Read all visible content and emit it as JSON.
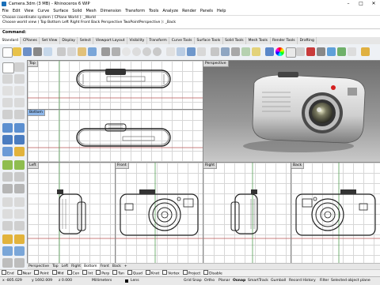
{
  "window": {
    "title": "Camera.3dm (3 MB) - Rhinoceros 6 WIP",
    "minimize": "–",
    "maximize": "□",
    "close": "✕"
  },
  "menu": [
    "File",
    "Edit",
    "View",
    "Curve",
    "Surface",
    "Solid",
    "Mesh",
    "Dimension",
    "Transform",
    "Tools",
    "Analyze",
    "Render",
    "Panels",
    "Help"
  ],
  "history": [
    "Choose coordinate system ( CPlane  World ): _World",
    "Choose world view ( Top  Bottom  Left  Right  Front  Back  Perspective  TwoPointPerspective ): _Back"
  ],
  "command": {
    "label": "Command:"
  },
  "toolbar_tabs": [
    "Standard",
    "CPlanes",
    "Set View",
    "Display",
    "Select",
    "Viewport Layout",
    "Visibility",
    "Transform",
    "Curve Tools",
    "Surface Tools",
    "Solid Tools",
    "Mesh Tools",
    "Render Tools",
    "Drafting"
  ],
  "toolbar_tabs_active": 0,
  "viewports": {
    "top": "Top",
    "bottom": "Bottom",
    "perspective": "Perspective",
    "left": "Left",
    "front": "Front",
    "right": "Right",
    "back": "Back"
  },
  "viewport_tabs": [
    "Perspective",
    "Top",
    "Left",
    "Right",
    "Bottom",
    "Front",
    "Back",
    "+"
  ],
  "viewport_tabs_active": 4,
  "osnaps": [
    {
      "label": "End",
      "checked": false
    },
    {
      "label": "Near",
      "checked": false
    },
    {
      "label": "Point",
      "checked": false
    },
    {
      "label": "Mid",
      "checked": false
    },
    {
      "label": "Cen",
      "checked": false
    },
    {
      "label": "Int",
      "checked": false
    },
    {
      "label": "Perp",
      "checked": false
    },
    {
      "label": "Tan",
      "checked": false
    },
    {
      "label": "Quad",
      "checked": false
    },
    {
      "label": "Knot",
      "checked": false
    },
    {
      "label": "Vertex",
      "checked": false
    },
    {
      "label": "Project",
      "checked": false
    },
    {
      "label": "Disable",
      "checked": false
    }
  ],
  "status": {
    "x": "x -805.029",
    "y": "y 1692.009",
    "z": "z 0.000",
    "units": "Millimeters",
    "layer": "Lens",
    "grid_snap": "Grid Snap",
    "ortho": "Ortho",
    "planar": "Planar",
    "osnap": "Osnap",
    "smarttrack": "SmartTrack",
    "gumball": "Gumball",
    "record_history": "Record History",
    "filter": "Filter",
    "selection": "Selected object plane"
  },
  "colors": {
    "active_label": "#8fb7e8",
    "layer_swatch": "#000000",
    "camera_red": "#d42020"
  }
}
